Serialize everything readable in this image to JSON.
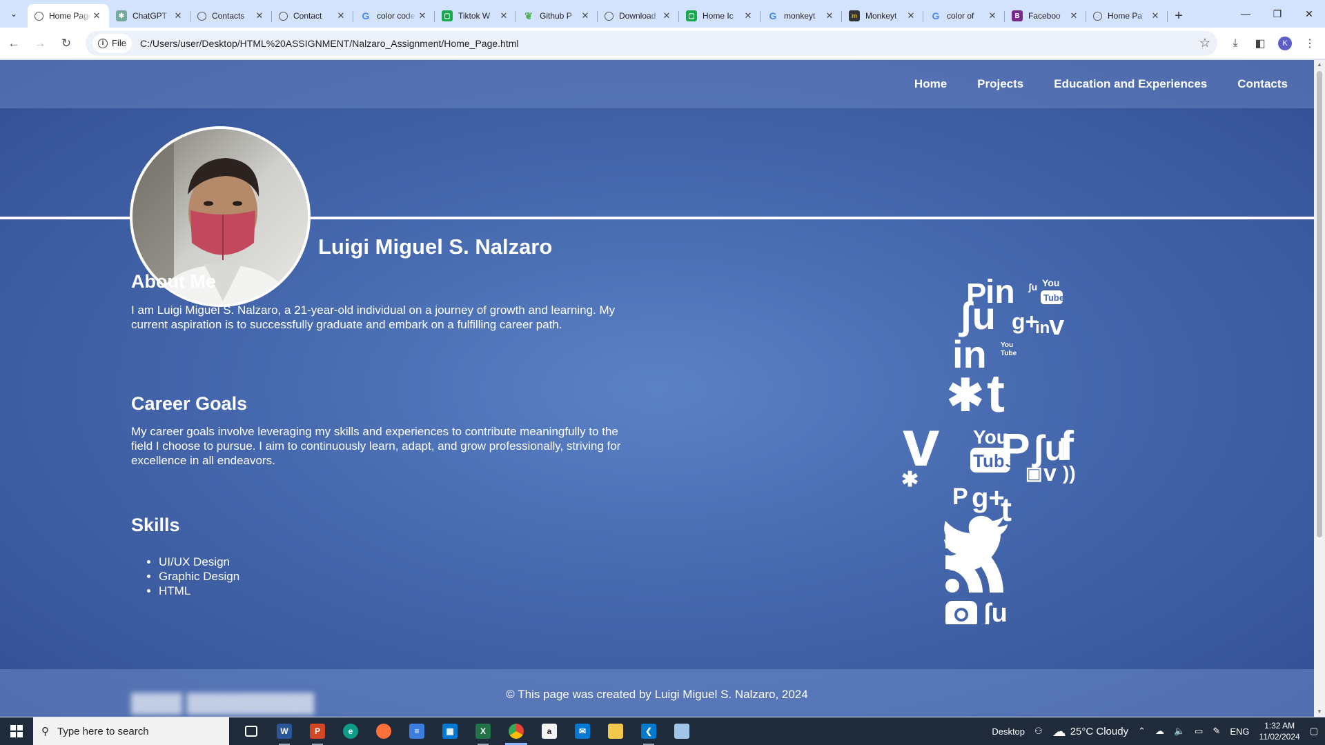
{
  "browser": {
    "tabs": [
      {
        "title": "Home Page",
        "icon": "globe-icon",
        "active": true
      },
      {
        "title": "ChatGPT",
        "icon": "chatgpt-icon",
        "active": false
      },
      {
        "title": "Contacts",
        "icon": "globe-icon",
        "active": false
      },
      {
        "title": "Contact",
        "icon": "globe-icon",
        "active": false
      },
      {
        "title": "color code",
        "icon": "google-icon",
        "active": false
      },
      {
        "title": "Tiktok W",
        "icon": "green-square-icon",
        "active": false
      },
      {
        "title": "Github P",
        "icon": "leaf-icon",
        "active": false
      },
      {
        "title": "Download",
        "icon": "globe-icon",
        "active": false
      },
      {
        "title": "Home Ic",
        "icon": "green-square-icon",
        "active": false
      },
      {
        "title": "monkeyt",
        "icon": "google-icon",
        "active": false
      },
      {
        "title": "Monkeyt",
        "icon": "monkeytype-icon",
        "active": false
      },
      {
        "title": "color of",
        "icon": "google-icon",
        "active": false
      },
      {
        "title": "Faceboo",
        "icon": "facebook-b-icon",
        "active": false
      },
      {
        "title": "Home Pa",
        "icon": "globe-icon",
        "active": false
      }
    ],
    "chip_label": "File",
    "url": "C:/Users/user/Desktop/HTML%20ASSIGNMENT/Nalzaro_Assignment/Home_Page.html",
    "profile_initial": "K",
    "colors": {
      "tabbar": "#d3e3fd",
      "omnibox": "#edf2fa"
    }
  },
  "site": {
    "nav": [
      "Home",
      "Projects",
      "Education and Experiences",
      "Contacts"
    ],
    "name": "Luigi Miguel S. Nalzaro",
    "about_title": "About Me",
    "about_text": "I am Luigi Miguel S. Nalzaro, a 21-year-old individual on a journey of growth and learning. My current aspiration is to successfully graduate and embark on a fulfilling career path.",
    "goals_title": "Career Goals",
    "goals_text": "My career goals involve leveraging my skills and experiences to contribute meaningfully to the field I choose to pursue. I aim to continuously learn, adapt, and grow professionally, striving for excellence in all endeavors.",
    "skills_title": "Skills",
    "skills": [
      "UI/UX Design",
      "Graphic Design",
      "HTML"
    ],
    "footer": "© This page was created by Luigi Miguel S. Nalzaro, 2024",
    "colors": {
      "background": "#4567ad",
      "text": "#ffffff"
    },
    "social_art_icons": [
      "pinterest",
      "linkedin",
      "youtube",
      "stumbleupon",
      "google-plus",
      "vimeo",
      "rss",
      "tumblr",
      "yelp",
      "facebook",
      "instagram",
      "twitter"
    ]
  },
  "taskbar": {
    "search_placeholder": "Type here to search",
    "apps": [
      "task-view",
      "word",
      "powerpoint",
      "edge",
      "firefox",
      "app-blue",
      "store",
      "excel",
      "chrome",
      "amazon",
      "mail",
      "file-explorer",
      "vscode",
      "notepad"
    ],
    "desktop_label": "Desktop",
    "weather": "25°C  Cloudy",
    "lang": "ENG",
    "time": "1:32 AM",
    "date": "11/02/2024"
  }
}
